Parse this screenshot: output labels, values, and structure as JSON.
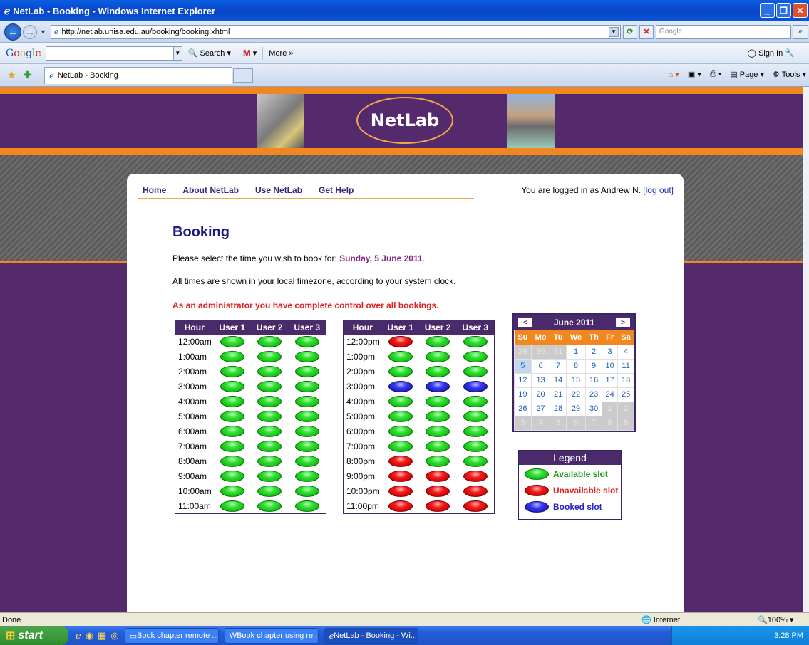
{
  "window": {
    "title": "NetLab - Booking - Windows Internet Explorer"
  },
  "browser": {
    "url": "http://netlab.unisa.edu.au/booking/booking.xhtml",
    "search_placeholder": "Google",
    "google_toolbar": {
      "search_label": "Search",
      "more_label": "More »",
      "signin_label": "Sign In"
    },
    "tab_label": "NetLab - Booking",
    "commands": {
      "page_label": "Page",
      "tools_label": "Tools"
    }
  },
  "site": {
    "logo_text": "NetLab",
    "nav": [
      "Home",
      "About NetLab",
      "Use NetLab",
      "Get Help"
    ],
    "logged_in_prefix": "You are logged in as Andrew N.",
    "logout_label": "[log out]"
  },
  "booking": {
    "heading": "Booking",
    "select_prefix": "Please select the time you wish to book for:",
    "select_date": "Sunday, 5 June 2011",
    "select_suffix": ".",
    "timezone_note": "All times are shown in your local timezone, according to your system clock.",
    "admin_note": "As an administrator you have complete control over all bookings.",
    "columns": [
      "Hour",
      "User 1",
      "User 2",
      "User 3"
    ],
    "am_rows": [
      {
        "hour": "12:00am",
        "slots": [
          "available",
          "available",
          "available"
        ]
      },
      {
        "hour": "1:00am",
        "slots": [
          "available",
          "available",
          "available"
        ]
      },
      {
        "hour": "2:00am",
        "slots": [
          "available",
          "available",
          "available"
        ]
      },
      {
        "hour": "3:00am",
        "slots": [
          "available",
          "available",
          "available"
        ]
      },
      {
        "hour": "4:00am",
        "slots": [
          "available",
          "available",
          "available"
        ]
      },
      {
        "hour": "5:00am",
        "slots": [
          "available",
          "available",
          "available"
        ]
      },
      {
        "hour": "6:00am",
        "slots": [
          "available",
          "available",
          "available"
        ]
      },
      {
        "hour": "7:00am",
        "slots": [
          "available",
          "available",
          "available"
        ]
      },
      {
        "hour": "8:00am",
        "slots": [
          "available",
          "available",
          "available"
        ]
      },
      {
        "hour": "9:00am",
        "slots": [
          "available",
          "available",
          "available"
        ]
      },
      {
        "hour": "10:00am",
        "slots": [
          "available",
          "available",
          "available"
        ]
      },
      {
        "hour": "11:00am",
        "slots": [
          "available",
          "available",
          "available"
        ]
      }
    ],
    "pm_rows": [
      {
        "hour": "12:00pm",
        "slots": [
          "unavailable",
          "available",
          "available"
        ]
      },
      {
        "hour": "1:00pm",
        "slots": [
          "available",
          "available",
          "available"
        ]
      },
      {
        "hour": "2:00pm",
        "slots": [
          "available",
          "available",
          "available"
        ]
      },
      {
        "hour": "3:00pm",
        "slots": [
          "booked",
          "booked",
          "booked"
        ]
      },
      {
        "hour": "4:00pm",
        "slots": [
          "available",
          "available",
          "available"
        ]
      },
      {
        "hour": "5:00pm",
        "slots": [
          "available",
          "available",
          "available"
        ]
      },
      {
        "hour": "6:00pm",
        "slots": [
          "available",
          "available",
          "available"
        ]
      },
      {
        "hour": "7:00pm",
        "slots": [
          "available",
          "available",
          "available"
        ]
      },
      {
        "hour": "8:00pm",
        "slots": [
          "unavailable",
          "available",
          "available"
        ]
      },
      {
        "hour": "9:00pm",
        "slots": [
          "unavailable",
          "unavailable",
          "unavailable"
        ]
      },
      {
        "hour": "10:00pm",
        "slots": [
          "unavailable",
          "unavailable",
          "unavailable"
        ]
      },
      {
        "hour": "11:00pm",
        "slots": [
          "unavailable",
          "unavailable",
          "unavailable"
        ]
      }
    ]
  },
  "calendar": {
    "month_label": "June 2011",
    "prev_label": "<",
    "next_label": ">",
    "weekdays": [
      "Su",
      "Mo",
      "Tu",
      "We",
      "Th",
      "Fr",
      "Sa"
    ],
    "weeks": [
      [
        {
          "d": "29",
          "o": true
        },
        {
          "d": "30",
          "o": true
        },
        {
          "d": "31",
          "o": true
        },
        {
          "d": "1"
        },
        {
          "d": "2"
        },
        {
          "d": "3"
        },
        {
          "d": "4"
        }
      ],
      [
        {
          "d": "5",
          "s": true
        },
        {
          "d": "6"
        },
        {
          "d": "7"
        },
        {
          "d": "8"
        },
        {
          "d": "9"
        },
        {
          "d": "10"
        },
        {
          "d": "11"
        }
      ],
      [
        {
          "d": "12"
        },
        {
          "d": "13"
        },
        {
          "d": "14"
        },
        {
          "d": "15"
        },
        {
          "d": "16"
        },
        {
          "d": "17"
        },
        {
          "d": "18"
        }
      ],
      [
        {
          "d": "19"
        },
        {
          "d": "20"
        },
        {
          "d": "21"
        },
        {
          "d": "22"
        },
        {
          "d": "23"
        },
        {
          "d": "24"
        },
        {
          "d": "25"
        }
      ],
      [
        {
          "d": "26"
        },
        {
          "d": "27"
        },
        {
          "d": "28"
        },
        {
          "d": "29"
        },
        {
          "d": "30"
        },
        {
          "d": "1",
          "o": true
        },
        {
          "d": "2",
          "o": true
        }
      ],
      [
        {
          "d": "3",
          "o": true
        },
        {
          "d": "4",
          "o": true
        },
        {
          "d": "5",
          "o": true
        },
        {
          "d": "6",
          "o": true
        },
        {
          "d": "7",
          "o": true
        },
        {
          "d": "8",
          "o": true
        },
        {
          "d": "9",
          "o": true
        }
      ]
    ]
  },
  "legend": {
    "title": "Legend",
    "items": [
      {
        "type": "available",
        "label": "Available slot",
        "color": "#1a9a1a"
      },
      {
        "type": "unavailable",
        "label": "Unavailable slot",
        "color": "#e22020"
      },
      {
        "type": "booked",
        "label": "Booked slot",
        "color": "#2626c8"
      }
    ]
  },
  "status": {
    "left": "Done",
    "zone": "Internet",
    "zoom": "100%"
  },
  "taskbar": {
    "start_label": "start",
    "tasks": [
      "Book chapter remote ...",
      "Book chapter using re...",
      "NetLab - Booking - Wi..."
    ],
    "clock": "3:28 PM"
  }
}
